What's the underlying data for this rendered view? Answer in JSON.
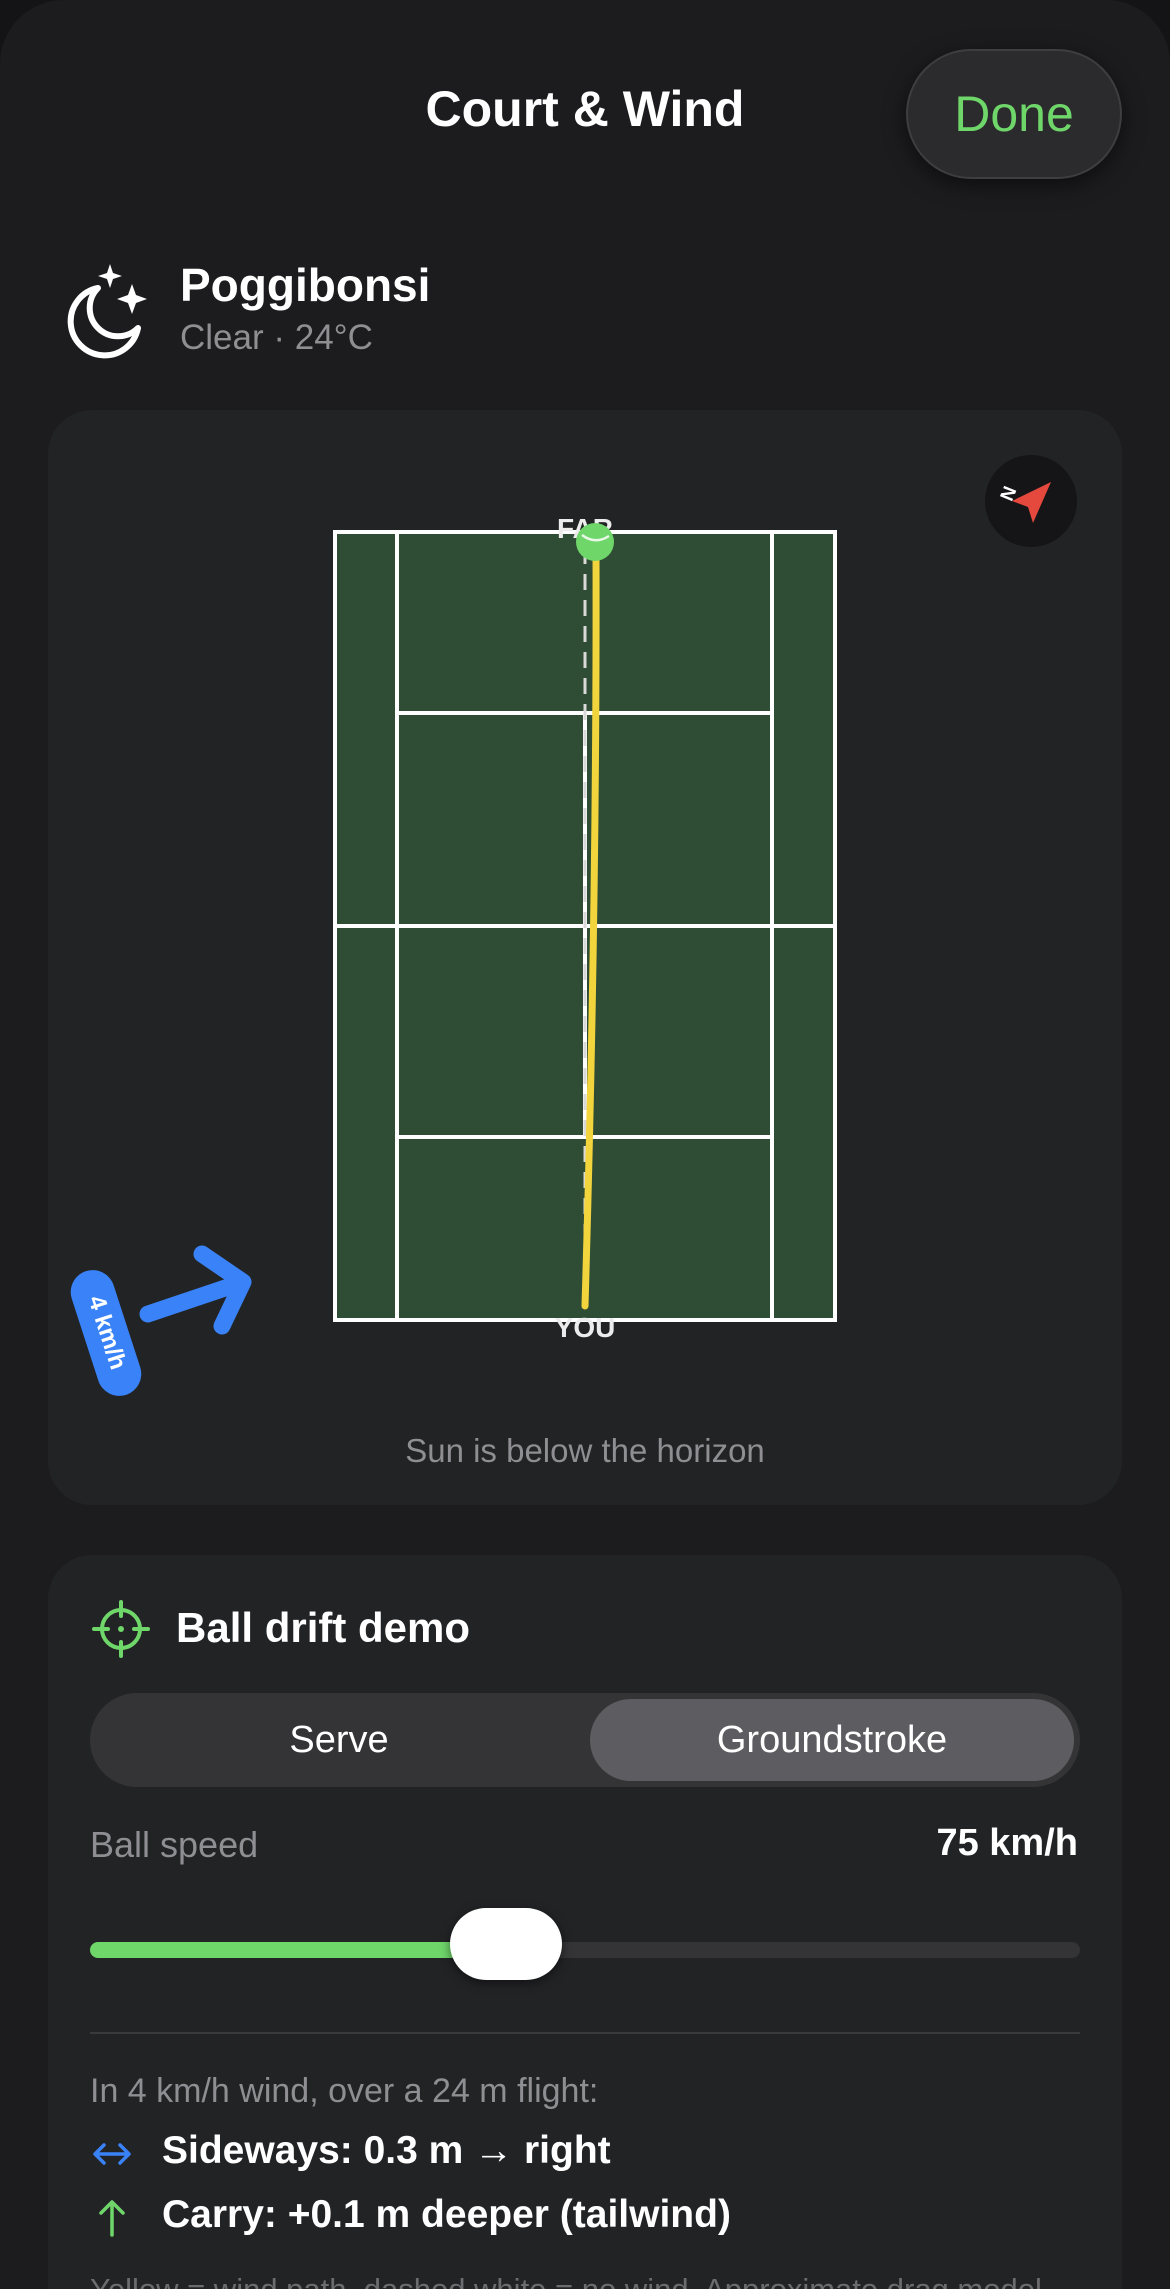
{
  "header": {
    "title": "Court & Wind",
    "done_label": "Done"
  },
  "location": {
    "icon": "moon-stars-icon",
    "city": "Poggibonsi",
    "conditions": "Clear · 24°C"
  },
  "court": {
    "far_label": "FAR",
    "near_label": "YOU",
    "compass_icon": "compass-needle-icon",
    "compass_letter": "N",
    "wind_speed_label": "4 km/h",
    "wind_arrow_icon": "wind-arrow-icon",
    "sun_status": "Sun is below the horizon",
    "colors": {
      "surface": "#2f4c34",
      "lines": "#ffffff",
      "ball_path": "#f2d43d",
      "wind": "#3a82f7",
      "ball": "#6fd66a",
      "compass_needle": "#e5483d"
    }
  },
  "drift": {
    "icon": "crosshair-icon",
    "title": "Ball drift demo",
    "modes": [
      "Serve",
      "Groundstroke"
    ],
    "selected_mode": "Groundstroke",
    "speed_label": "Ball speed",
    "speed_value": "75 km/h",
    "speed_slider_fraction": 0.42,
    "flight_summary": "In 4 km/h wind, over a 24 m flight:",
    "sideways_icon": "left-right-arrow-icon",
    "sideways_text": "Sideways: 0.3 m → right",
    "carry_icon": "up-arrow-icon",
    "carry_text": "Carry: +0.1 m deeper (tailwind)",
    "footnote": "Yellow = wind path, dashed white = no wind. Approximate drag model."
  }
}
